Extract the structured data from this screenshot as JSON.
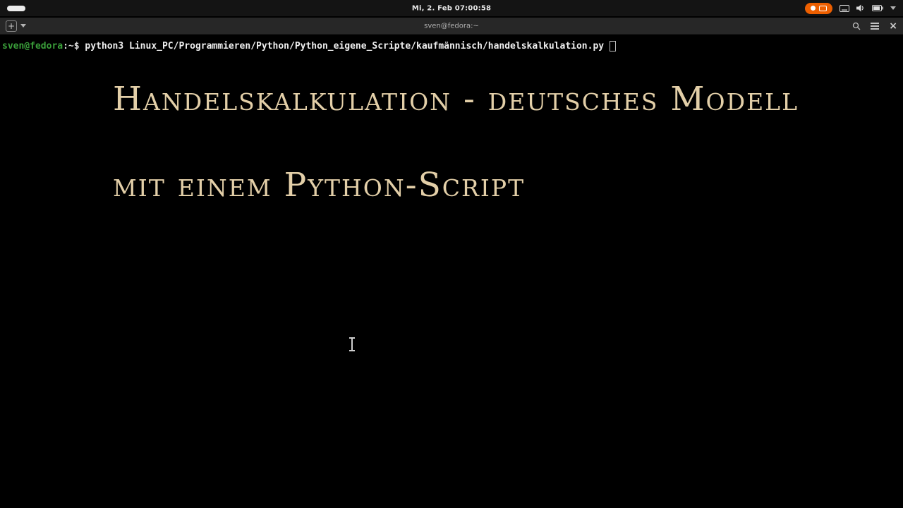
{
  "colors": {
    "record_indicator_orange": "#ed5f00",
    "prompt_green": "#3a9e3a",
    "heading_text": "#e3cfa8",
    "terminal_background": "#000000",
    "top_bar_background": "#141414",
    "titlebar_background": "#272727"
  },
  "system_bar": {
    "clock": "Mi, 2. Feb 07:00:58"
  },
  "terminal_window": {
    "titlebar": {
      "title": "sven@fedora:~",
      "new_tab_glyph": "+",
      "close_glyph": "×"
    },
    "prompt": {
      "user_host": "sven@fedora",
      "separator": ":~$ ",
      "command": "python3 Linux_PC/Programmieren/Python/Python_eigene_Scripte/kaufmännisch/handelskalkulation.py"
    },
    "output": {
      "heading_line1": "Handelskalkulation - deutsches Modell",
      "heading_line2": "mit einem Python-Script"
    }
  }
}
